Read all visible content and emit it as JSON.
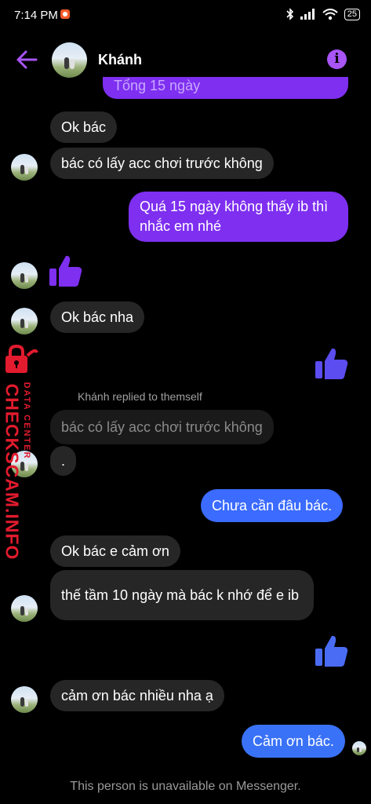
{
  "status_bar": {
    "time": "7:14 PM",
    "battery": "25"
  },
  "header": {
    "contact_name": "Khánh"
  },
  "messages": {
    "m0": "Tổng 15 ngày",
    "m1": "Ok bác",
    "m2": "bác có lấy acc chơi trước không",
    "m3": "Quá 15 ngày không thấy ib thì nhắc em nhé",
    "m5": "Ok bác nha",
    "reply_label": "Khánh replied to themself",
    "m7_quoted": "bác có lấy acc chơi trước không",
    "m7": ".",
    "m8": "Chưa cần đâu bác.",
    "m9": "Ok bác e cảm ơn",
    "m10": "thế tầm 10 ngày mà bác k nhớ để e ib",
    "m12": "cảm ơn bác nhiều nha ạ",
    "m13": "Cảm ơn bác."
  },
  "footer": {
    "note": "This person is unavailable on Messenger."
  },
  "watermark": {
    "main": "CHECKSCAM.INFO",
    "sub": "DATA CENTER"
  },
  "colors": {
    "purple": "#7e2ff0",
    "blue": "#3b6bff",
    "incoming": "#262626",
    "accent": "#a855f7"
  }
}
